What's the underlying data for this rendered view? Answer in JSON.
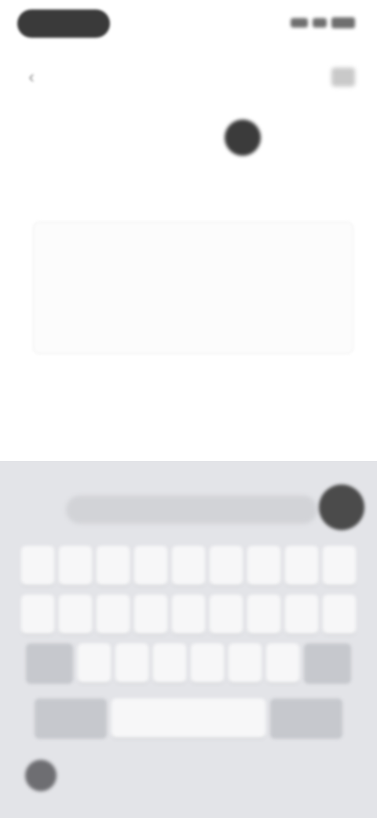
{
  "status_bar": {
    "icons": [
      "signal-icon",
      "wifi-icon",
      "battery-icon"
    ]
  },
  "header": {
    "back_icon": "‹",
    "title": "",
    "action_icon": "more-icon"
  },
  "main": {
    "headline": ""
  },
  "input": {
    "placeholder": ""
  },
  "keyboard": {
    "suggestion": "",
    "row1": [
      "",
      "",
      "",
      "",
      "",
      "",
      "",
      "",
      ""
    ],
    "row2": [
      "",
      "",
      "",
      "",
      "",
      "",
      "",
      "",
      ""
    ],
    "row3": [
      "",
      "",
      "",
      "",
      "",
      "",
      "",
      ""
    ],
    "space_label": "",
    "mode_label": "",
    "return_label": ""
  }
}
